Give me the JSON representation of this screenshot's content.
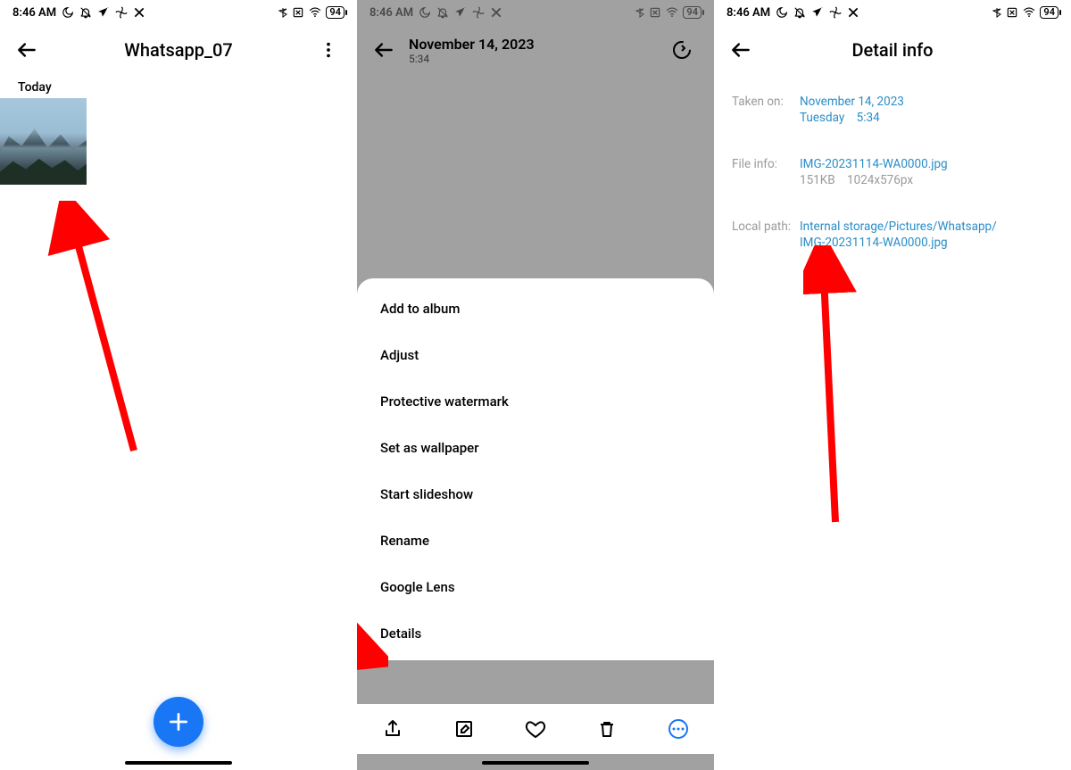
{
  "statusbar": {
    "time": "8:46 AM",
    "battery": "94"
  },
  "panel1": {
    "title": "Whatsapp_07",
    "section_label": "Today"
  },
  "panel2": {
    "header_date": "November 14, 2023",
    "header_time": "5:34",
    "menu_items": [
      "Add to album",
      "Adjust",
      "Protective watermark",
      "Set as wallpaper",
      "Start slideshow",
      "Rename",
      "Google Lens",
      "Details"
    ]
  },
  "panel3": {
    "title": "Detail info",
    "rows": {
      "taken_on_label": "Taken on:",
      "taken_on_value": "November 14, 2023",
      "taken_on_sub": "Tuesday    5:34",
      "file_info_label": "File info:",
      "file_info_value": "IMG-20231114-WA0000.jpg",
      "file_info_sub": "151KB    1024x576px",
      "local_path_label": "Local path:",
      "local_path_value_l1": "Internal storage/Pictures/Whatsapp/",
      "local_path_value_l2": "IMG-20231114-WA0000.jpg"
    }
  },
  "colors": {
    "accent": "#2a8dc8",
    "fab": "#1976f5",
    "arrow": "#ff0000"
  }
}
